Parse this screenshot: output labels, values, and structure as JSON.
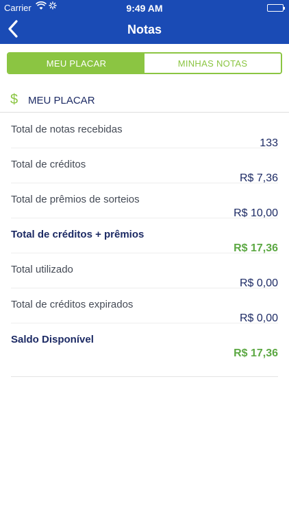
{
  "status_bar": {
    "carrier": "Carrier",
    "time": "9:49 AM"
  },
  "nav": {
    "title": "Notas"
  },
  "tabs": [
    {
      "label": "MEU PLACAR",
      "active": true
    },
    {
      "label": "MINHAS NOTAS",
      "active": false
    }
  ],
  "section": {
    "icon": "dollar-icon",
    "label": "MEU PLACAR"
  },
  "rows": [
    {
      "label": "Total de notas recebidas",
      "value": "133",
      "bold": false
    },
    {
      "label": "Total de créditos",
      "value": "R$ 7,36",
      "bold": false
    },
    {
      "label": "Total de prêmios de sorteios",
      "value": "R$ 10,00",
      "bold": false
    },
    {
      "label": "Total de créditos + prêmios",
      "value": "R$ 17,36",
      "bold": true
    },
    {
      "label": "Total utilizado",
      "value": "R$ 0,00",
      "bold": false
    },
    {
      "label": "Total de créditos expirados",
      "value": "R$ 0,00",
      "bold": false
    },
    {
      "label": "Saldo Disponível",
      "value": "R$ 17,36",
      "bold": true
    }
  ],
  "colors": {
    "header_blue": "#1a4bb5",
    "accent_green": "#8bc542",
    "value_green": "#5ca843",
    "text_navy": "#1c2a64"
  }
}
